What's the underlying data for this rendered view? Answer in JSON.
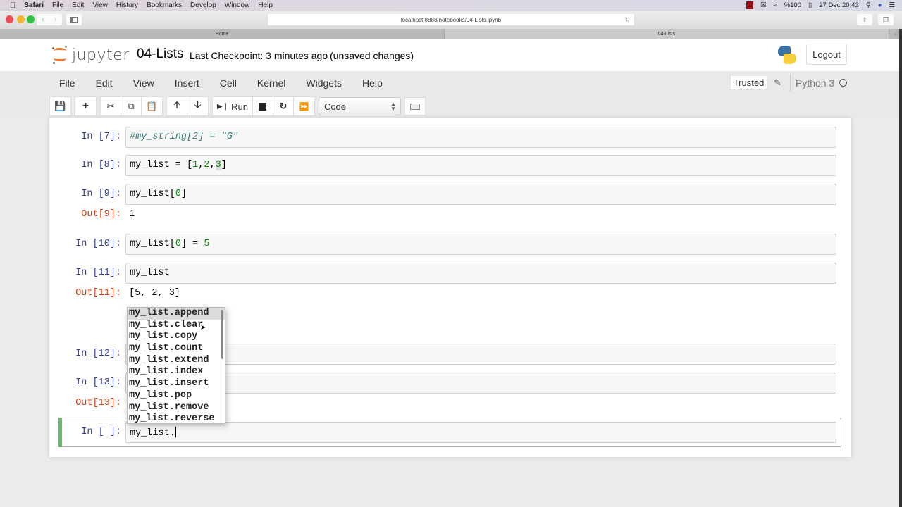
{
  "mac_menubar": {
    "apple_icon": "apple-logo-icon",
    "app_name": "Safari",
    "items": [
      "File",
      "Edit",
      "View",
      "History",
      "Bookmarks",
      "Develop",
      "Window",
      "Help"
    ],
    "battery": "%100",
    "datetime": "27 Dec  20:43"
  },
  "browser": {
    "url": "localhost:8888/notebooks/04-Lists.ipynb",
    "tabs": [
      {
        "label": "Home",
        "active": false
      },
      {
        "label": "04-Lists",
        "active": true
      }
    ]
  },
  "header": {
    "logo_text": "jupyter",
    "notebook_name": "04-Lists",
    "checkpoint": "Last Checkpoint: 3 minutes ago",
    "autosave_status": "(unsaved changes)",
    "logout_label": "Logout"
  },
  "menu": {
    "items": [
      "File",
      "Edit",
      "View",
      "Insert",
      "Cell",
      "Kernel",
      "Widgets",
      "Help"
    ],
    "trusted_label": "Trusted",
    "kernel_name": "Python 3"
  },
  "toolbar": {
    "run_label": "Run",
    "cell_type": "Code"
  },
  "cells": [
    {
      "in_prompt": "In [7]:",
      "source": "#my_string[2] = \"G\""
    },
    {
      "in_prompt": "In [8]:",
      "source": "my_list = [1,2,3]"
    },
    {
      "in_prompt": "In [9]:",
      "source": "my_list[0]",
      "out_prompt": "Out[9]:",
      "output": "1"
    },
    {
      "in_prompt": "In [10]:",
      "source": "my_list[0] = 5"
    },
    {
      "in_prompt": "In [11]:",
      "source": "my_list",
      "out_prompt": "Out[11]:",
      "output": "[5, 2, 3]"
    },
    {
      "in_prompt": "In [12]:",
      "source": ""
    },
    {
      "in_prompt": "In [13]:",
      "source": "",
      "out_prompt": "Out[13]:",
      "output": ""
    },
    {
      "in_prompt": "In [ ]:",
      "source": "my_list."
    }
  ],
  "completer": {
    "selected_index": 0,
    "options": [
      "my_list.append",
      "my_list.clear",
      "my_list.copy",
      "my_list.count",
      "my_list.extend",
      "my_list.index",
      "my_list.insert",
      "my_list.pop",
      "my_list.remove",
      "my_list.reverse"
    ]
  }
}
